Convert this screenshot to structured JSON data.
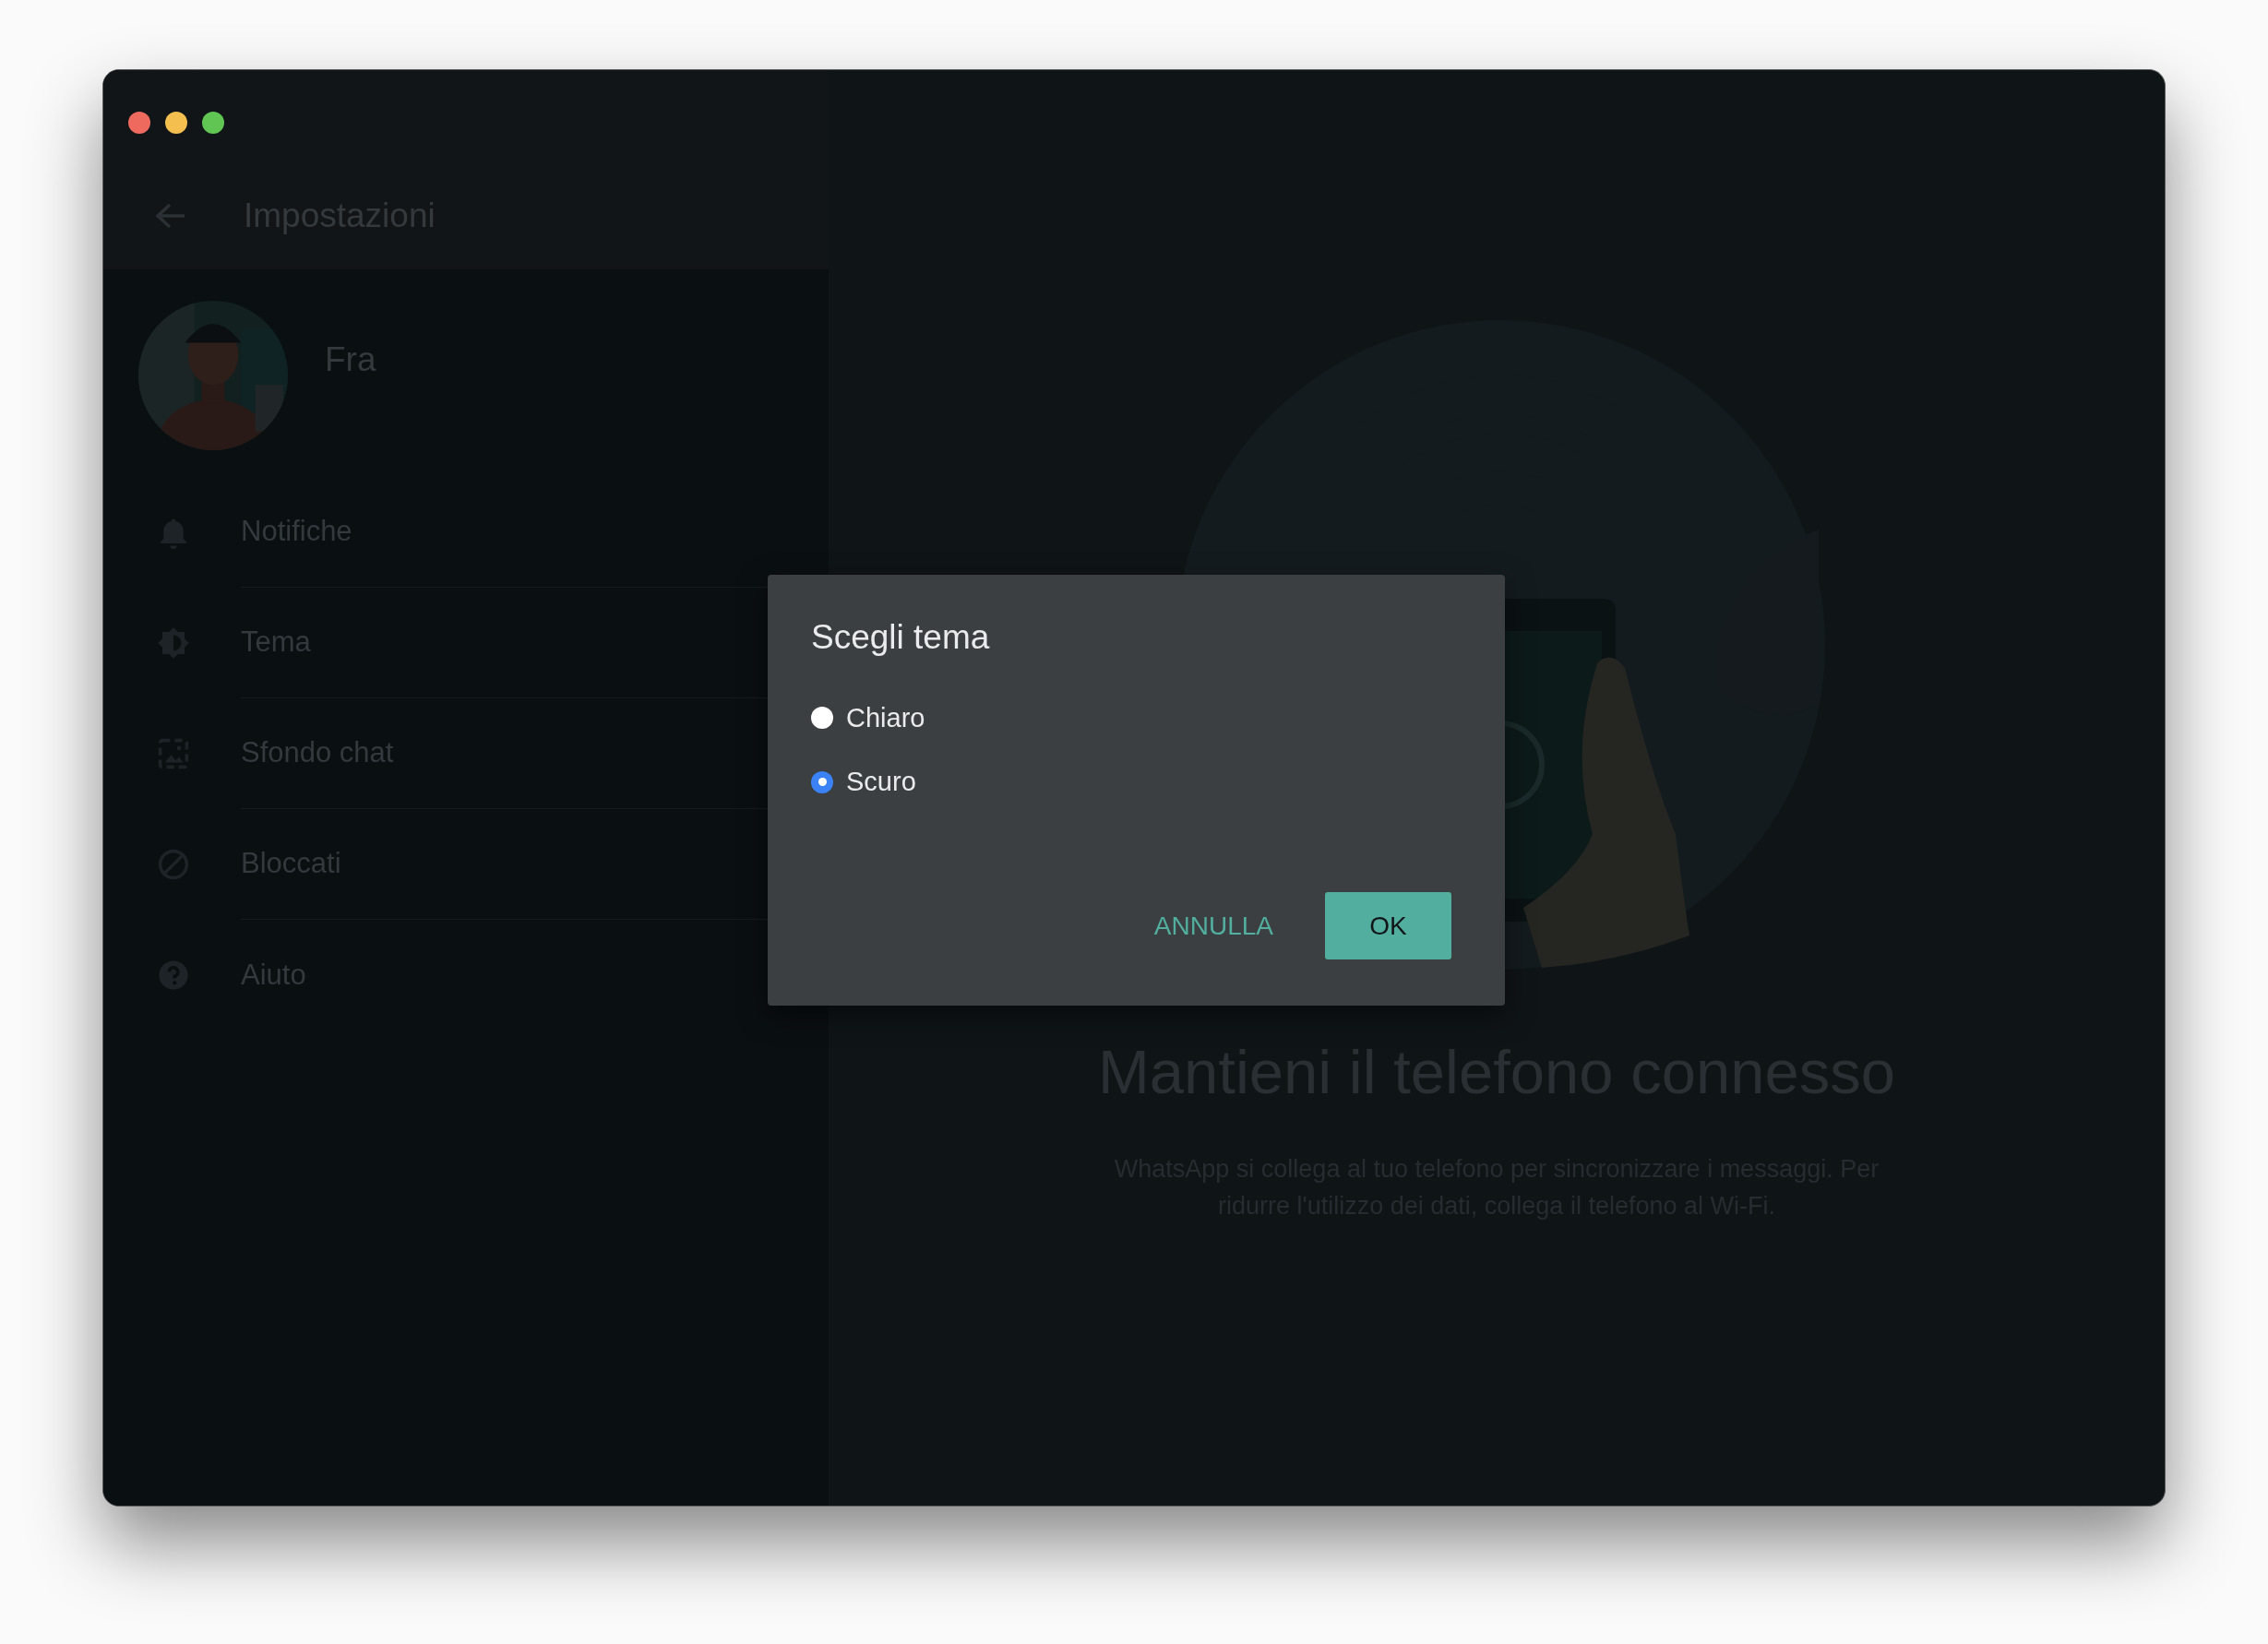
{
  "window": {
    "controls": [
      {
        "color": "#ee6a5f"
      },
      {
        "color": "#f5bf4f"
      },
      {
        "color": "#61c554"
      }
    ]
  },
  "sidebar": {
    "title": "Impostazioni",
    "profile": {
      "name": "Fra"
    },
    "items": [
      {
        "kind": "notifications",
        "label": "Notifiche"
      },
      {
        "kind": "theme",
        "label": "Tema"
      },
      {
        "kind": "wallpaper",
        "label": "Sfondo chat"
      },
      {
        "kind": "blocked",
        "label": "Bloccati"
      },
      {
        "kind": "help",
        "label": "Aiuto"
      }
    ]
  },
  "main": {
    "title": "Mantieni il telefono connesso",
    "description": "WhatsApp si collega al tuo telefono per sincronizzare i messaggi. Per ridurre l'utilizzo dei dati, collega il telefono al Wi-Fi."
  },
  "dialog": {
    "title": "Scegli tema",
    "options": [
      {
        "label": "Chiaro",
        "selected": false
      },
      {
        "label": "Scuro",
        "selected": true
      }
    ],
    "buttons": [
      {
        "kind": "text",
        "label": "ANNULLA"
      },
      {
        "kind": "filled",
        "label": "OK"
      }
    ]
  }
}
